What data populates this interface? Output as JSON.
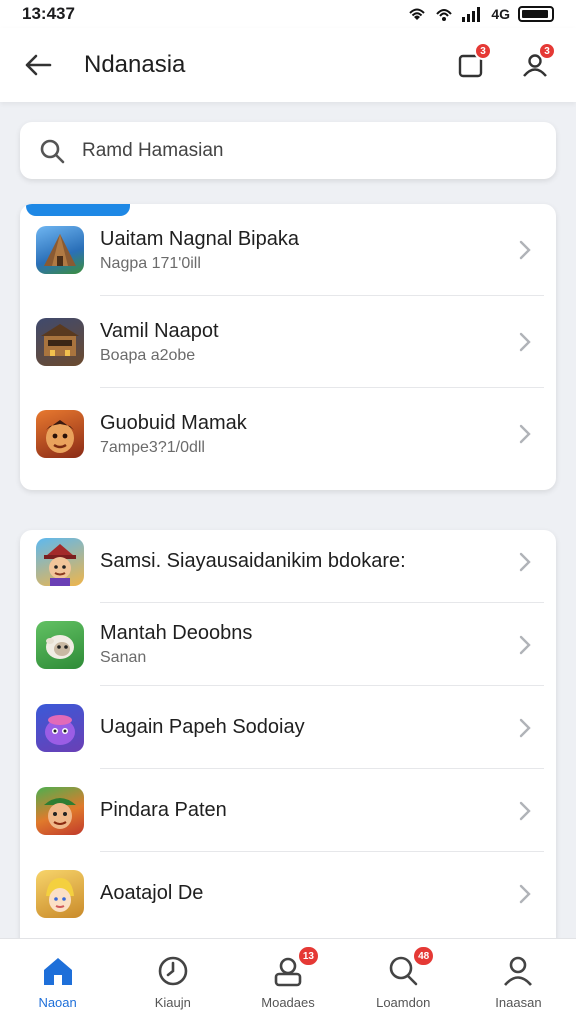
{
  "status_bar": {
    "time": "13:437",
    "network": "4G"
  },
  "header": {
    "title": "Ndanasia",
    "badge_1": "3",
    "badge_2": "3"
  },
  "search": {
    "placeholder": "Ramd Hamasian"
  },
  "section_1": {
    "items": [
      {
        "title": "Uaitam Nagnal Bipaka",
        "subtitle": "Nagpa 171'0ill",
        "icon": "pyramid-icon",
        "color": "#3f8fd8"
      },
      {
        "title": "Vamil Naapot",
        "subtitle": "Boapa a2obe",
        "icon": "building-icon",
        "color": "#6b4a2e"
      },
      {
        "title": "Guobuid Mamak",
        "subtitle": "7ampe3?1/0dll",
        "icon": "warrior-icon",
        "color": "#c94a20"
      }
    ]
  },
  "section_2": {
    "items": [
      {
        "title": "Samsi. Siayausaidanikim bdokare:",
        "subtitle": "",
        "icon": "character-icon",
        "color": "#f0b54a"
      },
      {
        "title": "Mantah Deoobns",
        "subtitle": "Sanan",
        "icon": "sheep-icon",
        "color": "#43a047"
      },
      {
        "title": "Uagain Papeh Sodoiay",
        "subtitle": "",
        "icon": "monster-icon",
        "color": "#6a3fb5"
      },
      {
        "title": "Pindara Paten",
        "subtitle": "",
        "icon": "elf-icon",
        "color": "#e07a2c"
      },
      {
        "title": "Aoatajol De",
        "subtitle": "",
        "icon": "girl-icon",
        "color": "#f3c34a"
      }
    ]
  },
  "bottom_nav": {
    "items": [
      {
        "label": "Naoan",
        "icon": "home-icon",
        "active": true,
        "badge": ""
      },
      {
        "label": "Kiaujn",
        "icon": "clock-icon",
        "active": false,
        "badge": ""
      },
      {
        "label": "Moadaes",
        "icon": "inbox-icon",
        "active": false,
        "badge": "13"
      },
      {
        "label": "Loamdon",
        "icon": "search-icon",
        "active": false,
        "badge": "48"
      },
      {
        "label": "Inaasan",
        "icon": "profile-icon",
        "active": false,
        "badge": ""
      }
    ]
  },
  "colors": {
    "accent": "#1e6fd9",
    "badge": "#e53935",
    "background": "#eef0f4"
  }
}
